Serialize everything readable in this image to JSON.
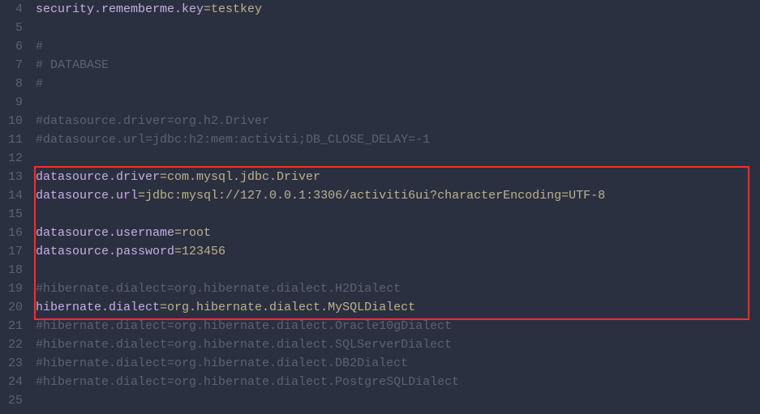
{
  "lines": [
    {
      "num": 4,
      "segments": [
        {
          "cls": "key",
          "text": "security.rememberme.key"
        },
        {
          "cls": "val",
          "text": "=testkey"
        }
      ]
    },
    {
      "num": 5,
      "segments": []
    },
    {
      "num": 6,
      "segments": [
        {
          "cls": "dim",
          "text": "#"
        }
      ]
    },
    {
      "num": 7,
      "segments": [
        {
          "cls": "dim",
          "text": "# DATABASE"
        }
      ]
    },
    {
      "num": 8,
      "segments": [
        {
          "cls": "dim",
          "text": "#"
        }
      ]
    },
    {
      "num": 9,
      "segments": []
    },
    {
      "num": 10,
      "segments": [
        {
          "cls": "dim",
          "text": "#datasource.driver=org.h2.Driver"
        }
      ]
    },
    {
      "num": 11,
      "segments": [
        {
          "cls": "dim",
          "text": "#datasource.url=jdbc:h2:mem:activiti;DB_CLOSE_DELAY=-1"
        }
      ]
    },
    {
      "num": 12,
      "segments": []
    },
    {
      "num": 13,
      "segments": [
        {
          "cls": "key",
          "text": "datasource.driver"
        },
        {
          "cls": "val",
          "text": "=com.mysql.jdbc.Driver"
        }
      ]
    },
    {
      "num": 14,
      "segments": [
        {
          "cls": "key",
          "text": "datasource.url"
        },
        {
          "cls": "val",
          "text": "=jdbc:mysql://127.0.0.1:3306/activiti6ui?characterEncoding=UTF-8"
        }
      ]
    },
    {
      "num": 15,
      "segments": []
    },
    {
      "num": 16,
      "segments": [
        {
          "cls": "key",
          "text": "datasource.username"
        },
        {
          "cls": "val",
          "text": "=root"
        }
      ]
    },
    {
      "num": 17,
      "segments": [
        {
          "cls": "key",
          "text": "datasource.password"
        },
        {
          "cls": "val",
          "text": "=123456"
        }
      ]
    },
    {
      "num": 18,
      "segments": []
    },
    {
      "num": 19,
      "segments": [
        {
          "cls": "dim",
          "text": "#hibernate.dialect=org.hibernate.dialect.H2Dialect"
        }
      ]
    },
    {
      "num": 20,
      "segments": [
        {
          "cls": "key",
          "text": "hibernate.dialect"
        },
        {
          "cls": "val",
          "text": "=org.hibernate.dialect.MySQLDialect"
        }
      ]
    },
    {
      "num": 21,
      "segments": [
        {
          "cls": "dim",
          "text": "#hibernate.dialect=org.hibernate.dialect.Oracle10gDialect"
        }
      ]
    },
    {
      "num": 22,
      "segments": [
        {
          "cls": "dim",
          "text": "#hibernate.dialect=org.hibernate.dialect.SQLServerDialect"
        }
      ]
    },
    {
      "num": 23,
      "segments": [
        {
          "cls": "dim",
          "text": "#hibernate.dialect=org.hibernate.dialect.DB2Dialect"
        }
      ]
    },
    {
      "num": 24,
      "segments": [
        {
          "cls": "dim",
          "text": "#hibernate.dialect=org.hibernate.dialect.PostgreSQLDialect"
        }
      ]
    },
    {
      "num": 25,
      "segments": []
    }
  ]
}
